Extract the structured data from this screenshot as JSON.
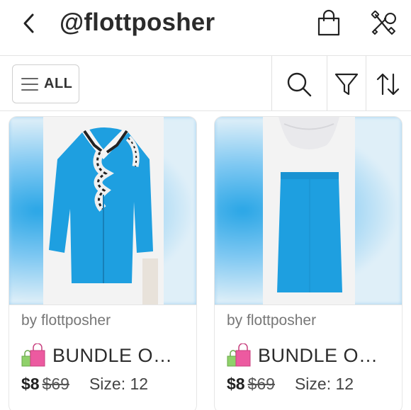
{
  "header": {
    "title": "@flottposher",
    "back_icon": "chevron-left-icon",
    "bag_icon": "shopping-bag-icon",
    "tools_icon": "tools-icon"
  },
  "filters": {
    "all_label": "ALL",
    "menu_icon": "hamburger-icon",
    "search_icon": "search-icon",
    "filter_icon": "funnel-icon",
    "sort_icon": "sort-icon"
  },
  "listings": [
    {
      "byline": "by flottposher",
      "title": "BUNDLE O…",
      "badge_icon": "bundle-bags-icon",
      "price": "$8",
      "original_price": "$69",
      "size": "Size: 12",
      "item": "jacket"
    },
    {
      "byline": "by flottposher",
      "title": "BUNDLE O…",
      "badge_icon": "bundle-bags-icon",
      "price": "$8",
      "original_price": "$69",
      "size": "Size: 12",
      "item": "skirt"
    }
  ],
  "colors": {
    "garment_blue": "#1e9fe0",
    "border": "#e4e4e4",
    "bag_pink": "#ec5aa0",
    "bag_green": "#8fd16a"
  }
}
